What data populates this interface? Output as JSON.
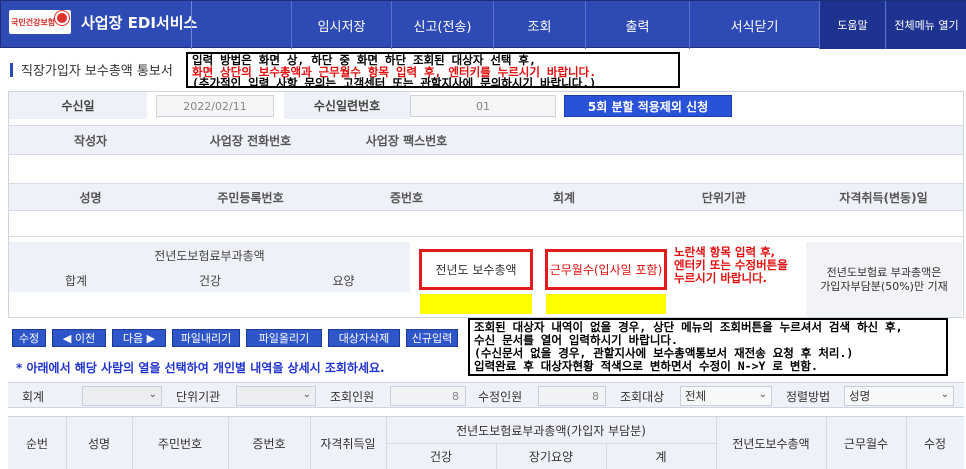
{
  "header": {
    "logo_text": "국민건강보험",
    "app_title": "사업장 EDI서비스",
    "nav": [
      "임시저장",
      "신고(전송)",
      "조회",
      "출력",
      "서식닫기"
    ],
    "help": "도움말",
    "all_menu": "전체메뉴 열기"
  },
  "page": {
    "title": "직장가입자 보수총액 통보서"
  },
  "notice_top": {
    "line1": "입력 방법은 화면 상, 하단 중 화면 하단 조회된 대상자 선택 후,",
    "line2": "화면 상단의 보수총액과 근무월수 항목 입력 후, 엔터키를 누르시기 바랍니다.",
    "line3": "(추가적인 입력 사항 문의는 고객센터 또는 관할지사에 문의하시기 바랍니다.)"
  },
  "form": {
    "received_date_label": "수신일",
    "received_date_value": "2022/02/11",
    "serial_label": "수신일련번호",
    "serial_value": "01",
    "split_button": "5회 분할 적용제외 신청",
    "row1_headers": [
      "작성자",
      "사업장 전화번호",
      "사업장 팩스번호"
    ],
    "row2_headers": [
      "성명",
      "주민등록번호",
      "증번호",
      "회계",
      "단위기관",
      "자격취득(변동)일"
    ],
    "premium_total_label": "전년도보험료부과총액",
    "premium_sub": [
      "합계",
      "건강",
      "요양"
    ],
    "salary_total_label": "전년도 보수총액",
    "work_months_label": "근무월수(입사일 포함)",
    "side_note": "노란색 항목 입력 후,\n엔터키 또는 수정버튼을\n누르시기 바랍니다.",
    "gray_note": "전년도보험료 부과총액은\n가입자부담분(50%)만 기재"
  },
  "toolbar": {
    "buttons": [
      "수정",
      "◀ 이전",
      "다음 ▶",
      "파일내리기",
      "파일올리기",
      "대상자삭제",
      "신규입력"
    ],
    "hint": "* 아래에서 해당 사람의 열을 선택하여 개인별 내역을 상세시 조회하세요."
  },
  "notice_bottom": {
    "line1": "조회된 대상자 내역이 없을 경우, 상단 메뉴의 조회버튼을 누르셔서 검색 하신 후,",
    "line2": "수신 문서를 열어 입력하시기 바랍니다.",
    "line3": "(수신문서 없을 경우, 관할지사에 보수총액통보서 재전송 요청 후 처리.)",
    "line4": "입력완료 후 대상자현황 적색으로 변하면서 수정이 N->Y 로 변함."
  },
  "filters": {
    "account_label": "회계",
    "account_value": "",
    "unit_label": "단위기관",
    "unit_value": "",
    "lookup_count_label": "조회인원",
    "lookup_count_value": "8",
    "edit_count_label": "수정인원",
    "edit_count_value": "8",
    "target_label": "조회대상",
    "target_value": "전체",
    "sort_label": "정렬방법",
    "sort_value": "성명"
  },
  "grid": {
    "cols": [
      "순번",
      "성명",
      "주민번호",
      "증번호",
      "자격취득일"
    ],
    "group_label": "전년도보험료부과총액(가입자 부담분)",
    "group_sub": [
      "건강",
      "장기요양",
      "계"
    ],
    "tail_cols": [
      "전년도보수총액",
      "근무월수",
      "수정"
    ]
  },
  "colors": {
    "nav_blue": "#2e4bb5",
    "highlight_red": "#e41b1b",
    "input_yellow": "#ffff00"
  }
}
